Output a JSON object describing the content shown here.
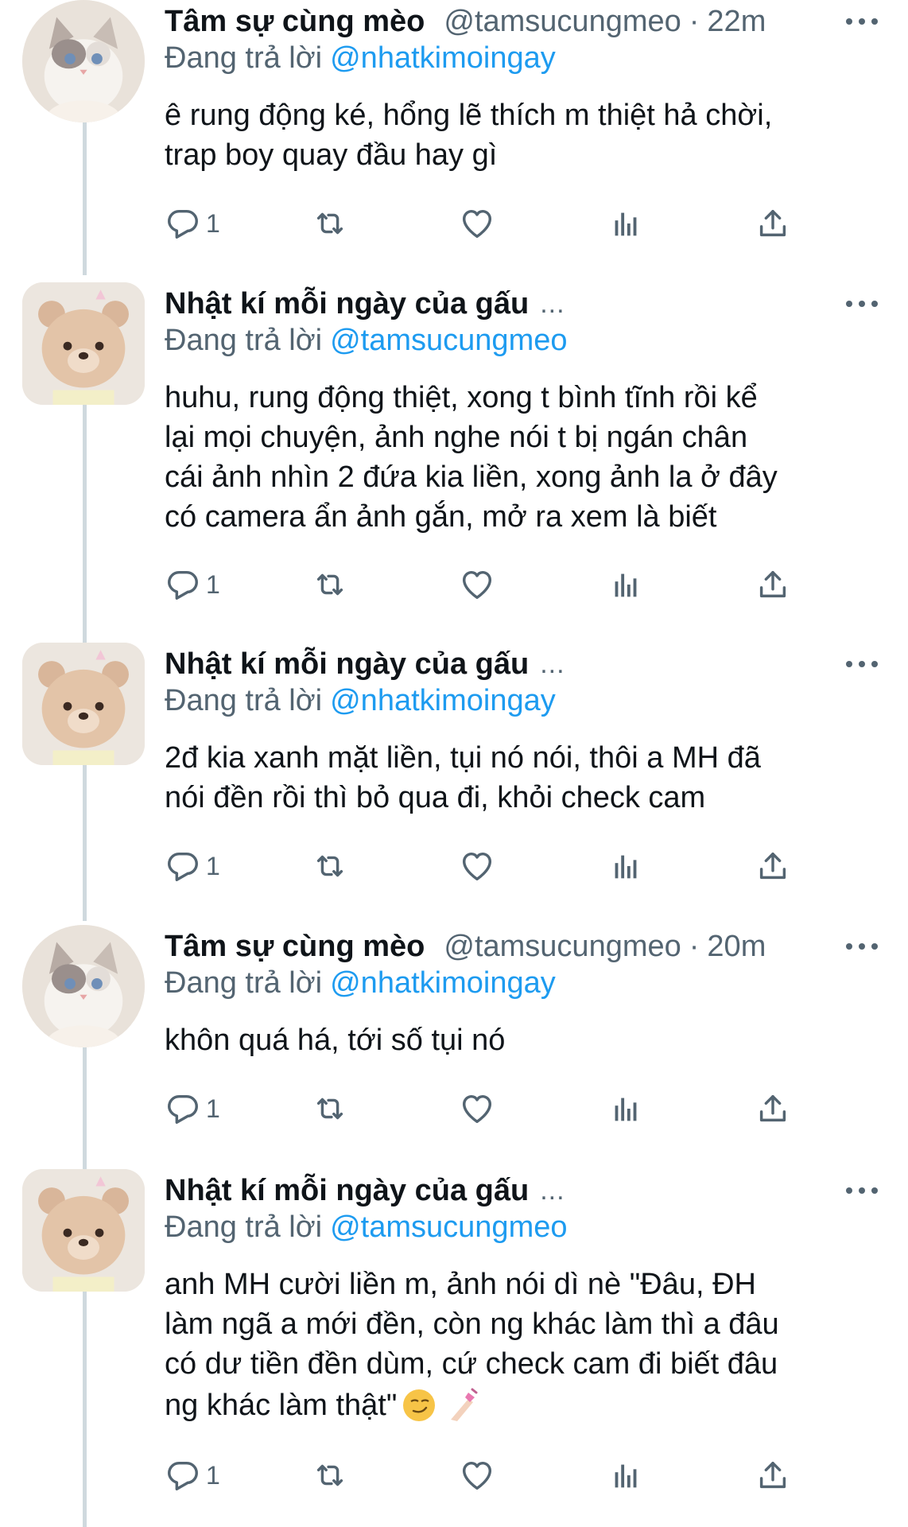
{
  "tweets": [
    {
      "avatar": "cat-avatar",
      "name": "Tâm sự cùng mèo",
      "handle": "@tamsucungmeo",
      "time": "22m",
      "reply_label": "Đang trả lời",
      "reply_to": "@nhatkimoingay",
      "lines": [
        "ê rung động ké, hổng lẽ thích m thiệt hả chời,",
        "trap boy quay đầu hay gì"
      ],
      "reply_count": "1"
    },
    {
      "avatar": "bear-avatar",
      "name": "Nhật kí mỗi ngày của gấu",
      "name_ellipsis": "...",
      "reply_label": "Đang trả lời",
      "reply_to": "@tamsucungmeo",
      "lines": [
        "huhu, rung động thiệt, xong t bình tĩnh rồi kể",
        "lại mọi chuyện, ảnh nghe nói t bị ngán chân",
        "cái ảnh nhìn 2 đứa kia liền, xong ảnh la ở đây",
        "có camera ẩn ảnh gắn, mở ra xem là biết"
      ],
      "reply_count": "1"
    },
    {
      "avatar": "bear-avatar",
      "name": "Nhật kí mỗi ngày của gấu",
      "name_ellipsis": "...",
      "reply_label": "Đang trả lời",
      "reply_to": "@nhatkimoingay",
      "lines": [
        "2đ kia xanh mặt liền, tụi nó nói, thôi a MH đã",
        "nói đền rồi thì bỏ qua đi, khỏi check cam"
      ],
      "reply_count": "1"
    },
    {
      "avatar": "cat-avatar",
      "name": "Tâm sự cùng mèo",
      "handle": "@tamsucungmeo",
      "time": "20m",
      "reply_label": "Đang trả lời",
      "reply_to": "@nhatkimoingay",
      "lines": [
        "khôn quá há, tới số tụi nó"
      ],
      "reply_count": "1"
    },
    {
      "avatar": "bear-avatar",
      "name": "Nhật kí mỗi ngày của gấu",
      "name_ellipsis": "...",
      "reply_label": "Đang trả lời",
      "reply_to": "@tamsucungmeo",
      "lines": [
        "anh MH cười liền m, ảnh nói dì nè \"Đâu, ĐH",
        "làm ngã a mới đền, còn ng khác làm thì a đâu",
        "có dư tiền đền dùm, cứ check cam đi biết đâu",
        "ng khác làm thật\""
      ],
      "emojis": [
        "smirking-face-emoji",
        "nail-polish-emoji"
      ],
      "reply_count": "1"
    }
  ],
  "icons": {
    "reply": "reply-icon",
    "retweet": "retweet-icon",
    "like": "like-icon",
    "views": "views-icon",
    "share": "share-icon",
    "more": "more-icon"
  },
  "colors": {
    "text": "#0f1419",
    "secondary": "#536471",
    "link": "#1d9bf0",
    "thread_line": "#cfd9de"
  }
}
